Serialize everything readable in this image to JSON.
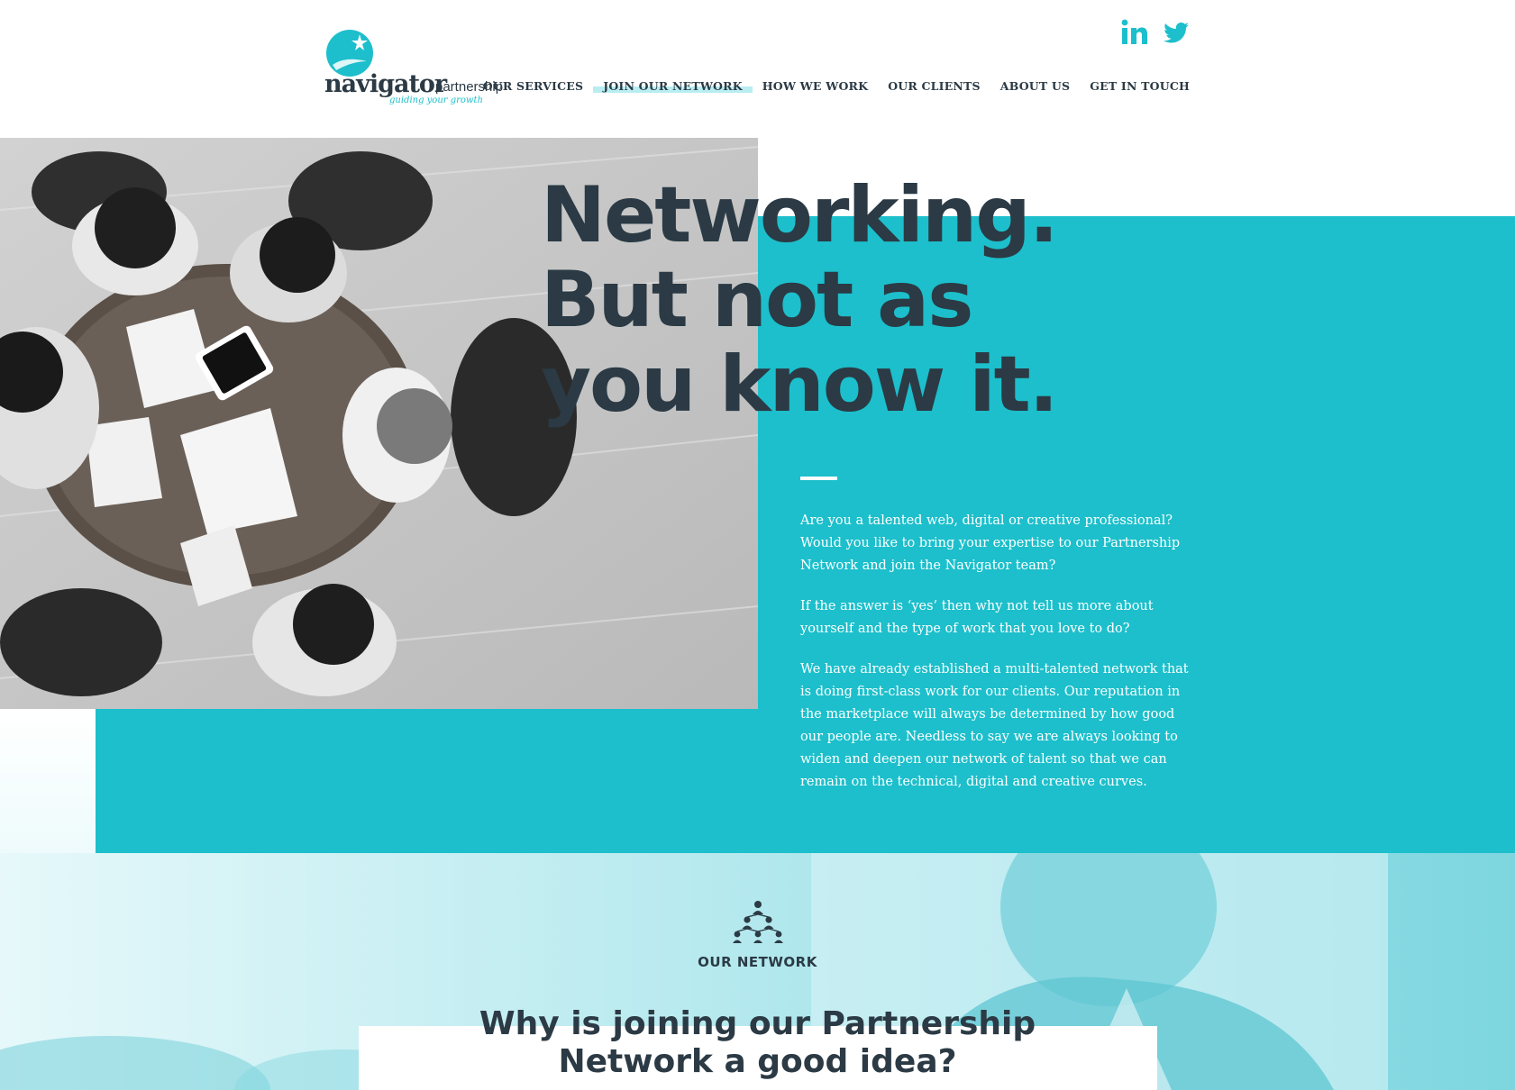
{
  "brand": {
    "name": "navigator",
    "suffix": "partnership",
    "tagline": "guiding your growth"
  },
  "social": [
    {
      "icon": "linkedin-icon"
    },
    {
      "icon": "twitter-icon"
    }
  ],
  "nav": {
    "items": [
      {
        "label": "OUR SERVICES",
        "active": false
      },
      {
        "label": "JOIN OUR NETWORK",
        "active": true
      },
      {
        "label": "HOW WE WORK",
        "active": false
      },
      {
        "label": "OUR CLIENTS",
        "active": false
      },
      {
        "label": "ABOUT US",
        "active": false
      },
      {
        "label": "GET IN TOUCH",
        "active": false
      }
    ]
  },
  "hero": {
    "title_lines": [
      "Networking.",
      "But not as",
      "you know it."
    ],
    "paragraphs": [
      "Are you a talented web, digital or creative professional? Would you like to bring your expertise to our Partnership Network and join the Navigator team?",
      "If the answer is ‘yes’ then why not tell us more about yourself and the type of work that you love to do?",
      "We have already established a multi-talented network that is doing first-class work for our clients. Our reputation in the marketplace will always be determined by how good our people are. Needless to say we are always looking to widen and deepen our network of talent so that we can remain on the technical, digital and creative curves."
    ]
  },
  "network": {
    "label": "OUR NETWORK",
    "icon": "network-icon",
    "heading_lines": [
      "Why is joining our Partnership",
      "Network a good idea?"
    ]
  },
  "colors": {
    "accent": "#1cbfcb",
    "text_dark": "#2b3a44",
    "nav_highlight": "#b8edf1",
    "section_tint": "#a9e6ec"
  }
}
